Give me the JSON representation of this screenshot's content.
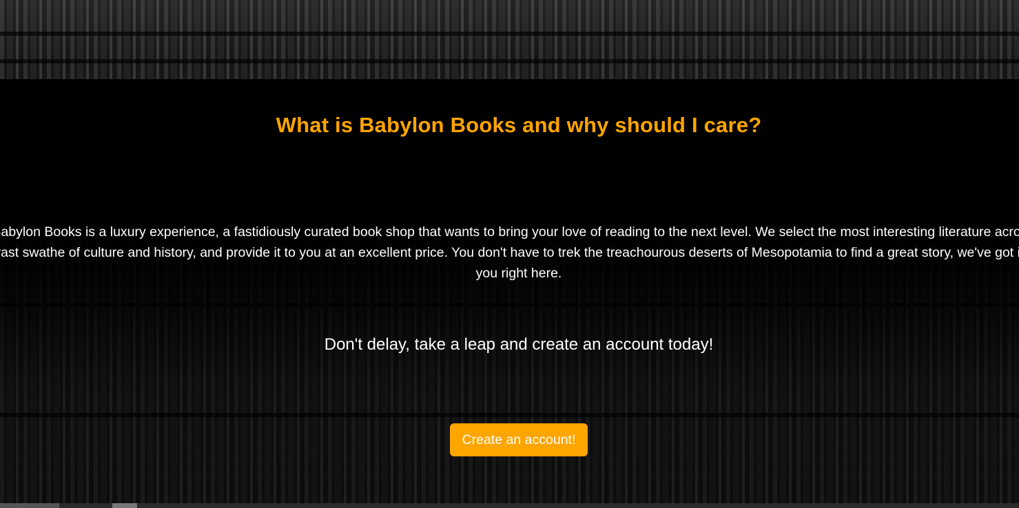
{
  "hero": {
    "heading": "What is Babylon Books and why should I care?",
    "intro": "Babylon Books is a luxury experience, a fastidiously curated book shop that wants to bring your love of reading to the next level. We select the most interesting literature across a vast swathe of culture and history, and provide it to you at an excellent price. You don't have to trek the treachourous deserts of Mesopotamia to find a great story, we've got it for you right here.",
    "cta_text": "Don't delay, take a leap and create an account today!",
    "cta_button_label": "Create an account!"
  },
  "colors": {
    "accent": "#ffa500",
    "text": "#ffffff",
    "band": "#000000"
  }
}
